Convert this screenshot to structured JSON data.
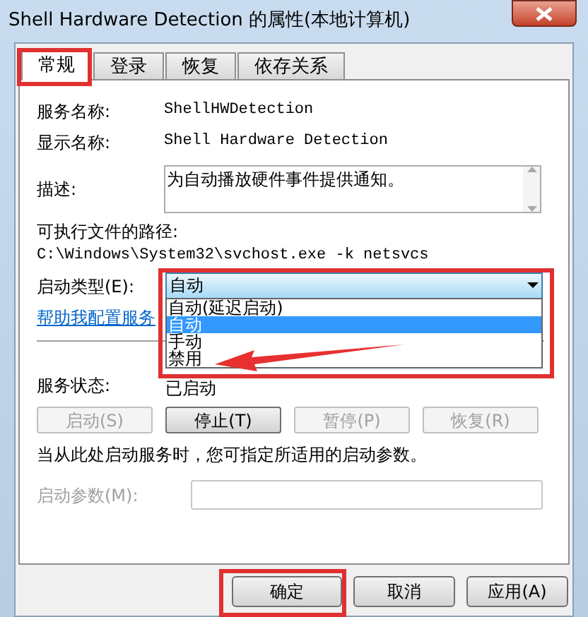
{
  "window": {
    "title": "Shell Hardware Detection 的属性(本地计算机)"
  },
  "tabs": [
    {
      "label": "常规",
      "selected": true
    },
    {
      "label": "登录",
      "selected": false
    },
    {
      "label": "恢复",
      "selected": false
    },
    {
      "label": "依存关系",
      "selected": false
    }
  ],
  "service_name": {
    "label": "服务名称:",
    "value": "ShellHWDetection"
  },
  "display_name": {
    "label": "显示名称:",
    "value": "Shell Hardware Detection"
  },
  "description": {
    "label": "描述:",
    "value": "为自动播放硬件事件提供通知。"
  },
  "path": {
    "label": "可执行文件的路径:",
    "value": "C:\\Windows\\System32\\svchost.exe -k netsvcs"
  },
  "startup_type": {
    "label": "启动类型(E):",
    "value": "自动",
    "expanded": true,
    "options": [
      {
        "label": "自动(延迟启动)",
        "selected": false
      },
      {
        "label": "自动",
        "selected": true
      },
      {
        "label": "手动",
        "selected": false
      },
      {
        "label": "禁用",
        "selected": false
      }
    ]
  },
  "help_link": "帮助我配置服务",
  "service_status": {
    "label": "服务状态:",
    "value": "已启动"
  },
  "service_buttons": [
    {
      "label": "启动(S)",
      "disabled": true
    },
    {
      "label": "停止(T)",
      "disabled": false
    },
    {
      "label": "暂停(P)",
      "disabled": true
    },
    {
      "label": "恢复(R)",
      "disabled": true
    }
  ],
  "hint": "当从此处启动服务时，您可指定所适用的启动参数。",
  "start_params": {
    "label": "启动参数(M):",
    "disabled": true
  },
  "dialog_buttons": [
    {
      "label": "确定"
    },
    {
      "label": "取消"
    },
    {
      "label": "应用(A)"
    }
  ]
}
